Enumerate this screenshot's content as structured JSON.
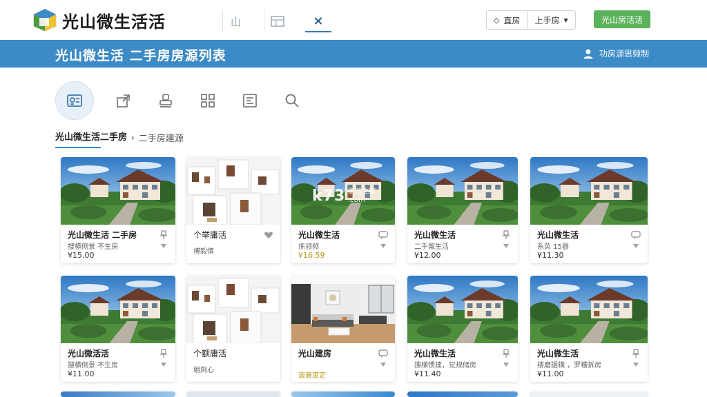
{
  "app": {
    "title": "光山微生活活"
  },
  "top_tabs": [
    {
      "label": "山",
      "icon": "chart-icon"
    },
    {
      "label": "",
      "icon": "table-icon"
    },
    {
      "label": "×",
      "icon": "close-icon"
    }
  ],
  "top_actions": {
    "home_label": "直房",
    "menu_label": "上手房"
  },
  "cta": {
    "label": "光山房活活"
  },
  "header": {
    "title": "光山微生活  二手房房源列表",
    "user_label": "功房源思频制"
  },
  "breadcrumb": {
    "root": "光山微生活二手房",
    "separator": "›",
    "leaf": "二手房建源"
  },
  "toolbar": {
    "icons": [
      "listing-icon",
      "share-icon",
      "stamp-icon",
      "grid-icon",
      "form-icon",
      "search-icon"
    ]
  },
  "watermark": {
    "big": "k73",
    "cn": "游戏之家",
    "domain": ".com"
  },
  "listings": [
    {
      "title": "光山微生活 二手房",
      "subtitle": "搜横侧景 不生房",
      "price": "¥15.00",
      "photo": "villa",
      "action_icon": "pin-icon"
    },
    {
      "title": "个举庸活",
      "subtitle": "搏毅情",
      "price": "",
      "photo": "interior-collage",
      "action_icon": "heart-icon"
    },
    {
      "title": "光山微生活",
      "subtitle": "炼领频",
      "price": "¥16.59",
      "photo": "villa",
      "action_icon": "chat-icon",
      "price_accent": true
    },
    {
      "title": "光山微生活",
      "subtitle": "二手氟生活",
      "price": "¥12.00",
      "photo": "villa",
      "action_icon": "pin-icon"
    },
    {
      "title": "光山微生活",
      "subtitle": "系奂 15器",
      "price": "¥11.30",
      "photo": "villa",
      "action_icon": "chat-icon"
    },
    {
      "title": "光山微活活",
      "subtitle": "搜横侧景 不生房",
      "price": "¥11.00",
      "photo": "villa",
      "action_icon": "pin-icon"
    },
    {
      "title": "个额庸活",
      "subtitle": "朝厕心",
      "price": "",
      "photo": "interior-collage",
      "action_icon": ""
    },
    {
      "title": "光山建房",
      "subtitle": "",
      "price": "装衰度定",
      "photo": "living-room",
      "action_icon": "chat-icon",
      "price_accent": true
    },
    {
      "title": "光山微生活",
      "subtitle": "搜横惯建，觉规储房",
      "price": "¥11.40",
      "photo": "villa",
      "action_icon": "pin-icon"
    },
    {
      "title": "光山微生活",
      "subtitle": "楼磨据横 ，罗糟拆房",
      "price": "¥11.00",
      "photo": "villa",
      "action_icon": "pin-icon"
    }
  ]
}
